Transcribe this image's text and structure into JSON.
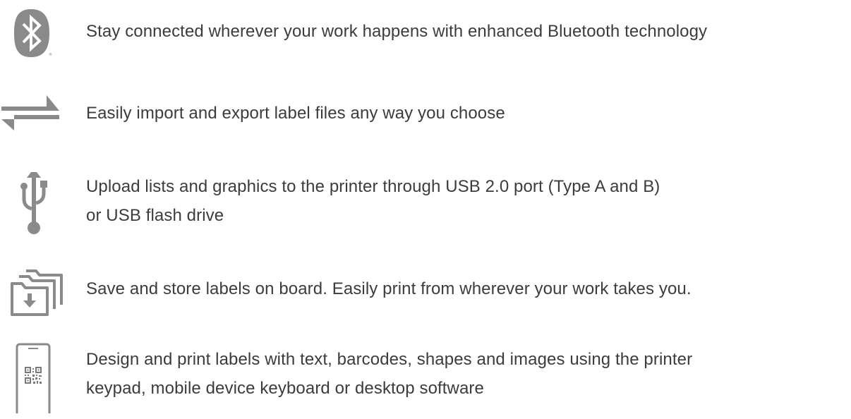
{
  "features": [
    {
      "icon": "bluetooth-icon",
      "lines": [
        "Stay connected wherever your work happens with enhanced Bluetooth technology"
      ]
    },
    {
      "icon": "transfer-arrows-icon",
      "lines": [
        "Easily import and export label files any way you choose"
      ]
    },
    {
      "icon": "usb-icon",
      "lines": [
        "Upload lists and graphics to the printer through USB 2.0 port (Type A and B)",
        "or USB flash drive"
      ]
    },
    {
      "icon": "folders-icon",
      "lines": [
        "Save and store labels on board. Easily print from wherever your work takes you."
      ]
    },
    {
      "icon": "mobile-qr-icon",
      "lines": [
        "Design and print labels with text, barcodes, shapes and images using the printer",
        "keypad, mobile device keyboard or desktop software"
      ]
    }
  ],
  "colors": {
    "icon": "#8a8a8a",
    "text": "#3c3c3c",
    "background": "#ffffff"
  }
}
